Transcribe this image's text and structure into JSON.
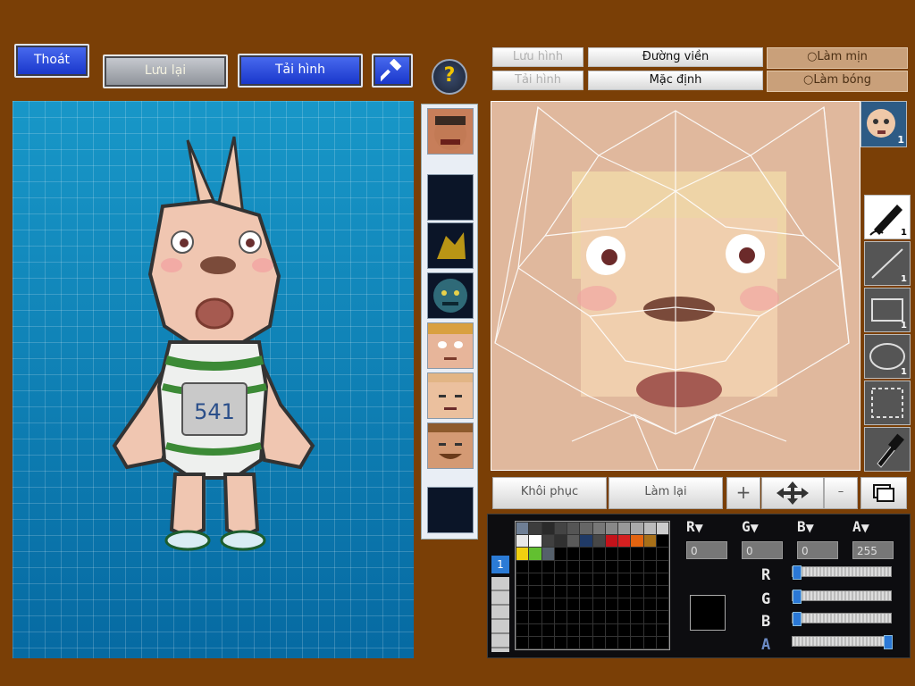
{
  "toolbar": {
    "exit_label": "Thoát",
    "save_label": "Lưu lại",
    "upload_label": "Tải hình",
    "help_symbol": "?"
  },
  "editor_buttons": {
    "save_image": "Lưu hình",
    "load_image": "Tải hình",
    "outline": "Đường viền",
    "default": "Mặc định",
    "smooth": "Làm mịn",
    "shine": "Làm bóng"
  },
  "bottom_buttons": {
    "restore": "Khôi phục",
    "redo": "Làm lại"
  },
  "character": {
    "jersey_number": "541"
  },
  "palette": {
    "channels": [
      {
        "label": "R",
        "value": "0"
      },
      {
        "label": "G",
        "value": "0"
      },
      {
        "label": "B",
        "value": "0"
      },
      {
        "label": "A",
        "value": "255"
      }
    ],
    "slider_labels": [
      "R",
      "G",
      "B",
      "A"
    ],
    "slider_levels": [
      0,
      0,
      0,
      1
    ],
    "page_tab": "1",
    "swatches_row1": [
      "#6f7f95",
      "#3d3d3d",
      "#2a2a2a",
      "#444",
      "#555",
      "#666",
      "#777",
      "#888",
      "#999",
      "#aaa",
      "#bbb",
      "#ccc"
    ],
    "swatches_row2": [
      "#e8e8e8",
      "#ffffff",
      "#404040",
      "#303030",
      "#5a5a5a",
      "#203a66",
      "#474747",
      "#c4121a",
      "#d52020",
      "#e36410",
      "#a87018",
      ""
    ],
    "swatches_row3": [
      "#f0d010",
      "#62c030",
      "#55606b"
    ]
  },
  "tools": {
    "pencil_count": "1",
    "line_count": "1",
    "rect_count": "1",
    "ellipse_count": "1",
    "face_part_count": "1"
  },
  "colors": {
    "background": "#7a3f06",
    "canvas_blue": "#0d82ba",
    "button_blue": "#1734c9"
  }
}
